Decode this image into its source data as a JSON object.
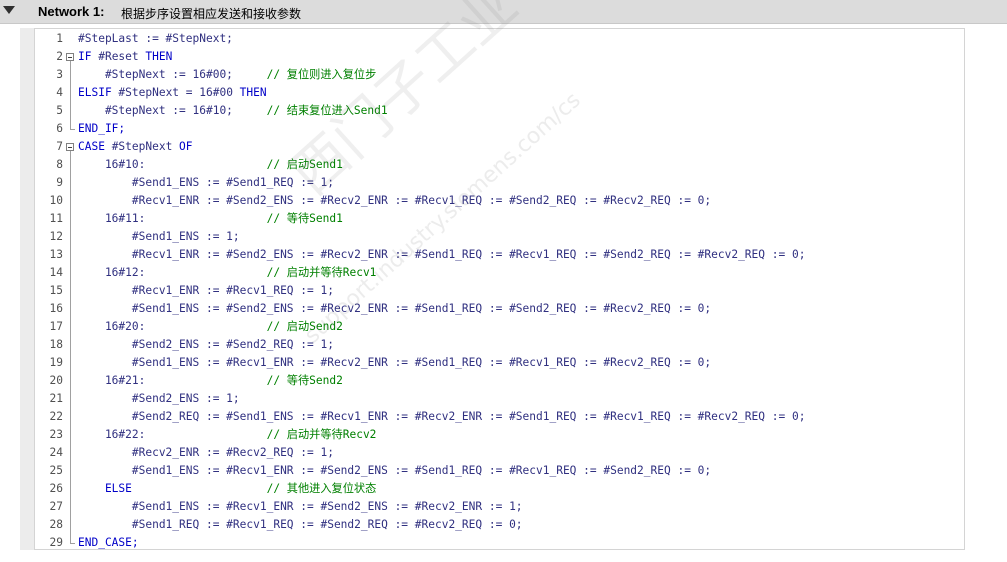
{
  "network": {
    "label": "Network 1:",
    "title": "根据步序设置相应发送和接收参数",
    "expanded": true
  },
  "colors": {
    "header_bg": "#dcdcdc",
    "keyword": "#0000c8",
    "variable": "#303080",
    "comment": "#008000"
  },
  "watermark": {
    "text": "西门子工业 找答案",
    "url": "support.industry.siemens.com/cs"
  },
  "code": {
    "lines": [
      {
        "n": "1",
        "segs": [
          {
            "t": "#StepLast := #StepNext;",
            "c": "var"
          }
        ]
      },
      {
        "n": "2",
        "fold": "start",
        "segs": [
          {
            "t": "IF ",
            "c": "kw"
          },
          {
            "t": "#Reset ",
            "c": "var"
          },
          {
            "t": "THEN",
            "c": "kw"
          }
        ]
      },
      {
        "n": "3",
        "segs": [
          {
            "t": "    #StepNext := 16#00;     ",
            "c": "var"
          },
          {
            "t": "// 复位则进入复位步",
            "c": "cmt"
          }
        ]
      },
      {
        "n": "4",
        "segs": [
          {
            "t": "ELSIF ",
            "c": "kw"
          },
          {
            "t": "#StepNext = 16#00 ",
            "c": "var"
          },
          {
            "t": "THEN",
            "c": "kw"
          }
        ]
      },
      {
        "n": "5",
        "segs": [
          {
            "t": "    #StepNext := 16#10;     ",
            "c": "var"
          },
          {
            "t": "// 结束复位进入Send1",
            "c": "cmt"
          }
        ]
      },
      {
        "n": "6",
        "fold": "end",
        "segs": [
          {
            "t": "END_IF;",
            "c": "kw"
          }
        ]
      },
      {
        "n": "7",
        "fold": "start",
        "segs": [
          {
            "t": "CASE ",
            "c": "kw"
          },
          {
            "t": "#StepNext ",
            "c": "var"
          },
          {
            "t": "OF",
            "c": "kw"
          }
        ]
      },
      {
        "n": "8",
        "segs": [
          {
            "t": "    16#10:                  ",
            "c": "var"
          },
          {
            "t": "// 启动Send1",
            "c": "cmt"
          }
        ]
      },
      {
        "n": "9",
        "segs": [
          {
            "t": "        #Send1_ENS := #Send1_REQ := 1;",
            "c": "var"
          }
        ]
      },
      {
        "n": "10",
        "segs": [
          {
            "t": "        #Recv1_ENR := #Send2_ENS := #Recv2_ENR := #Recv1_REQ := #Send2_REQ := #Recv2_REQ := 0;",
            "c": "var"
          }
        ]
      },
      {
        "n": "11",
        "segs": [
          {
            "t": "    16#11:                  ",
            "c": "var"
          },
          {
            "t": "// 等待Send1",
            "c": "cmt"
          }
        ]
      },
      {
        "n": "12",
        "segs": [
          {
            "t": "        #Send1_ENS := 1;",
            "c": "var"
          }
        ]
      },
      {
        "n": "13",
        "segs": [
          {
            "t": "        #Recv1_ENR := #Send2_ENS := #Recv2_ENR := #Send1_REQ := #Recv1_REQ := #Send2_REQ := #Recv2_REQ := 0;",
            "c": "var"
          }
        ]
      },
      {
        "n": "14",
        "segs": [
          {
            "t": "    16#12:                  ",
            "c": "var"
          },
          {
            "t": "// 启动并等待Recv1",
            "c": "cmt"
          }
        ]
      },
      {
        "n": "15",
        "segs": [
          {
            "t": "        #Recv1_ENR := #Recv1_REQ := 1;",
            "c": "var"
          }
        ]
      },
      {
        "n": "16",
        "segs": [
          {
            "t": "        #Send1_ENS := #Send2_ENS := #Recv2_ENR := #Send1_REQ := #Send2_REQ := #Recv2_REQ := 0;",
            "c": "var"
          }
        ]
      },
      {
        "n": "17",
        "segs": [
          {
            "t": "    16#20:                  ",
            "c": "var"
          },
          {
            "t": "// 启动Send2",
            "c": "cmt"
          }
        ]
      },
      {
        "n": "18",
        "segs": [
          {
            "t": "        #Send2_ENS := #Send2_REQ := 1;",
            "c": "var"
          }
        ]
      },
      {
        "n": "19",
        "segs": [
          {
            "t": "        #Send1_ENS := #Recv1_ENR := #Recv2_ENR := #Send1_REQ := #Recv1_REQ := #Recv2_REQ := 0;",
            "c": "var"
          }
        ]
      },
      {
        "n": "20",
        "segs": [
          {
            "t": "    16#21:                  ",
            "c": "var"
          },
          {
            "t": "// 等待Send2",
            "c": "cmt"
          }
        ]
      },
      {
        "n": "21",
        "segs": [
          {
            "t": "        #Send2_ENS := 1;",
            "c": "var"
          }
        ]
      },
      {
        "n": "22",
        "segs": [
          {
            "t": "        #Send2_REQ := #Send1_ENS := #Recv1_ENR := #Recv2_ENR := #Send1_REQ := #Recv1_REQ := #Recv2_REQ := 0;",
            "c": "var"
          }
        ]
      },
      {
        "n": "23",
        "segs": [
          {
            "t": "    16#22:                  ",
            "c": "var"
          },
          {
            "t": "// 启动并等待Recv2",
            "c": "cmt"
          }
        ]
      },
      {
        "n": "24",
        "segs": [
          {
            "t": "        #Recv2_ENR := #Recv2_REQ := 1;",
            "c": "var"
          }
        ]
      },
      {
        "n": "25",
        "segs": [
          {
            "t": "        #Send1_ENS := #Recv1_ENR := #Send2_ENS := #Send1_REQ := #Recv1_REQ := #Send2_REQ := 0;",
            "c": "var"
          }
        ]
      },
      {
        "n": "26",
        "segs": [
          {
            "t": "    ELSE                    ",
            "c": "kw"
          },
          {
            "t": "// 其他进入复位状态",
            "c": "cmt"
          }
        ]
      },
      {
        "n": "27",
        "segs": [
          {
            "t": "        #Send1_ENS := #Recv1_ENR := #Send2_ENS := #Recv2_ENR := 1;",
            "c": "var"
          }
        ]
      },
      {
        "n": "28",
        "segs": [
          {
            "t": "        #Send1_REQ := #Recv1_REQ := #Send2_REQ := #Recv2_REQ := 0;",
            "c": "var"
          }
        ]
      },
      {
        "n": "29",
        "fold": "end",
        "segs": [
          {
            "t": "END_CASE;",
            "c": "kw"
          }
        ]
      }
    ]
  }
}
